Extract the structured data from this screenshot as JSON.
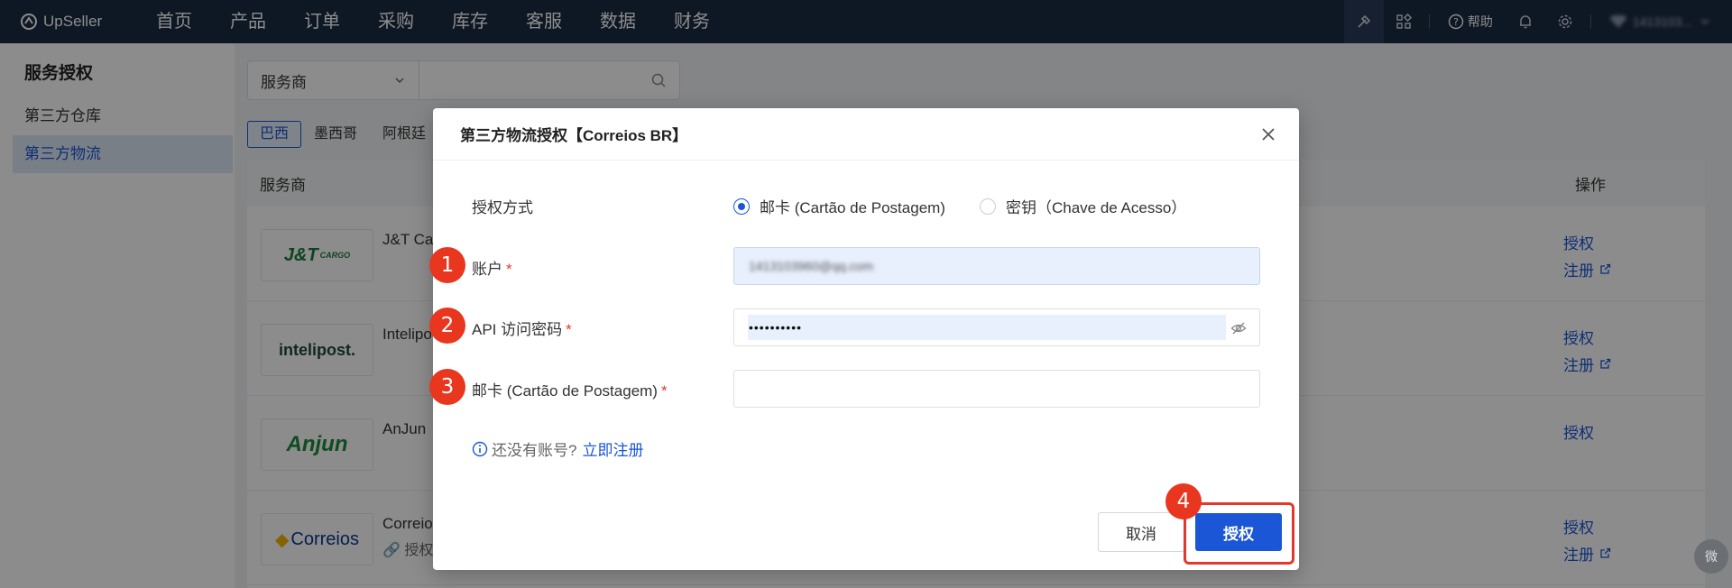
{
  "topbar": {
    "logo_text": "UpSeller",
    "nav": [
      "首页",
      "产品",
      "订单",
      "采购",
      "库存",
      "客服",
      "数据",
      "财务"
    ],
    "help_label": "帮助",
    "user_label": "1413103..."
  },
  "sidebar": {
    "title": "服务授权",
    "items": [
      {
        "label": "第三方仓库",
        "active": false
      },
      {
        "label": "第三方物流",
        "active": true
      }
    ]
  },
  "main": {
    "search": {
      "select_value": "服务商",
      "placeholder": ""
    },
    "country_tabs": [
      "巴西",
      "墨西哥",
      "阿根廷"
    ],
    "table": {
      "headers": [
        "服务商",
        "操作"
      ],
      "rows": [
        {
          "logo": "J&T CARGO",
          "name": "J&T Ca",
          "sub": "",
          "actions": [
            "授权",
            "注册"
          ]
        },
        {
          "logo": "intelipost.",
          "name": "Intelipo",
          "sub": "",
          "actions": [
            "授权",
            "注册"
          ]
        },
        {
          "logo": "Anjun",
          "name": "AnJun",
          "sub": "",
          "actions": [
            "授权"
          ]
        },
        {
          "logo": "Correios",
          "name": "Correios",
          "sub": "授权",
          "actions": [
            "授权",
            "注册"
          ]
        }
      ]
    }
  },
  "modal": {
    "title": "第三方物流授权【Correios BR】",
    "auth_method_label": "授权方式",
    "radio_options": [
      {
        "label": "邮卡 (Cartão de Postagem)",
        "checked": true
      },
      {
        "label": "密钥（Chave de Acesso）",
        "checked": false
      }
    ],
    "fields": {
      "account": {
        "label": "账户",
        "value": "1413103960@qq.com"
      },
      "api_password": {
        "label": "API 访问密码",
        "value": "••••••••••"
      },
      "postal_card": {
        "label": "邮卡 (Cartão de Postagem)",
        "value": ""
      }
    },
    "hint_text": "还没有账号?",
    "hint_link": "立即注册",
    "cancel_label": "取消",
    "ok_label": "授权"
  },
  "steps": [
    "1",
    "2",
    "3",
    "4"
  ],
  "wechat_label": "微",
  "colors": {
    "primary": "#1a56d6",
    "nav_bg": "#1b2a42",
    "step_red": "#e8361f",
    "required": "#e03a2f"
  }
}
